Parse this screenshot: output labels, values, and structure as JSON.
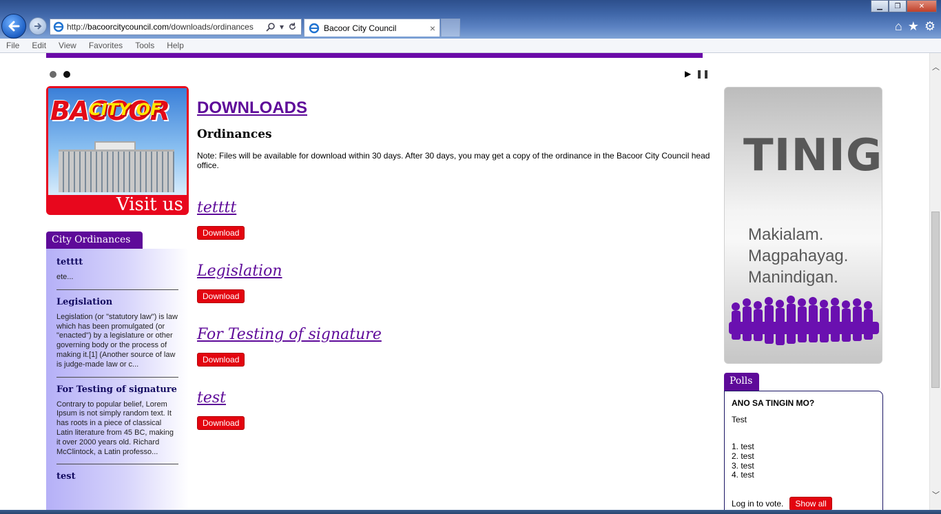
{
  "browser": {
    "url_prefix": "http://",
    "url_host": "bacoorcitycouncil.com",
    "url_path": "/downloads/ordinances",
    "tab_title": "Bacoor City Council",
    "tab_close": "×",
    "icons": [
      "back-arrow-icon",
      "forward-arrow-icon",
      "search-icon",
      "refresh-icon",
      "home-icon",
      "favorites-star-icon",
      "gear-icon"
    ]
  },
  "menu": [
    "File",
    "Edit",
    "View",
    "Favorites",
    "Tools",
    "Help"
  ],
  "banner": {
    "city_of": "CITY OF",
    "bacoor": "BACOOR",
    "visit": "Visit us"
  },
  "sidebar": {
    "tab_label": "City Ordinances",
    "items": [
      {
        "title": "tetttt",
        "desc": "ete..."
      },
      {
        "title": "Legislation",
        "desc": "Legislation (or \"statutory law\") is law which has been promulgated (or \"enacted\") by a legislature or other governing body or the process of making it.[1] (Another source of law is judge-made law or c..."
      },
      {
        "title": "For Testing of signature",
        "desc": "Contrary to popular belief, Lorem Ipsum is not simply random text. It has roots in a piece of classical Latin literature from 45 BC, making it over 2000 years old. Richard McClintock, a Latin professo..."
      },
      {
        "title": "test",
        "desc": ""
      }
    ]
  },
  "main": {
    "title": "DOWNLOADS",
    "subtitle": "Ordinances",
    "note": "Note: Files will be available for download within 30 days. After 30 days, you may get a copy of the ordinance in the Bacoor City Council head office.",
    "download_label": "Download",
    "downloads": [
      {
        "title": "tetttt"
      },
      {
        "title": "Legislation"
      },
      {
        "title": "For Testing of signature"
      },
      {
        "title": "test"
      }
    ]
  },
  "tinig": {
    "title": "TINIG",
    "line1": "Makialam.",
    "line2": "Magpahayag.",
    "line3": "Manindigan."
  },
  "polls": {
    "tab_label": "Polls",
    "question": "ANO SA TINGIN MO?",
    "desc": "Test",
    "options": [
      "1. test",
      "2. test",
      "3. test",
      "4. test"
    ],
    "login_text": "Log in to vote.",
    "show_all": "Show all"
  },
  "colors": {
    "accent_purple": "#5e0a99",
    "download_red": "#e3050f"
  }
}
